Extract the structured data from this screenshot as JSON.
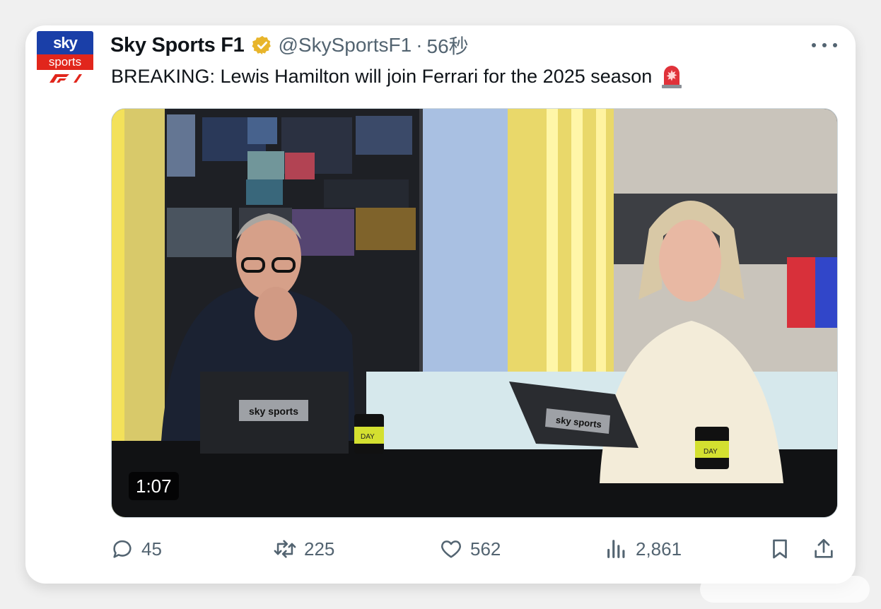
{
  "account": {
    "name": "Sky Sports F1",
    "handle": "@SkySportsF1",
    "separator": "·",
    "timestamp": "56秒",
    "avatar": {
      "top_text": "sky",
      "mid_text": "sports",
      "brand_blue": "#1a3fa8",
      "brand_red": "#e1261c"
    }
  },
  "tweet": {
    "text": "BREAKING: Lewis Hamilton will join Ferrari for the 2025 season",
    "emoji": "siren-icon"
  },
  "video": {
    "duration": "1:07",
    "desk_laptop_text": "sky sports",
    "mug_text": "DAY"
  },
  "actions": {
    "replies": "45",
    "retweets": "225",
    "likes": "562",
    "views": "2,861"
  },
  "colors": {
    "text_primary": "#0f1419",
    "text_secondary": "#536471",
    "verified_gold": "#e8b52b"
  }
}
